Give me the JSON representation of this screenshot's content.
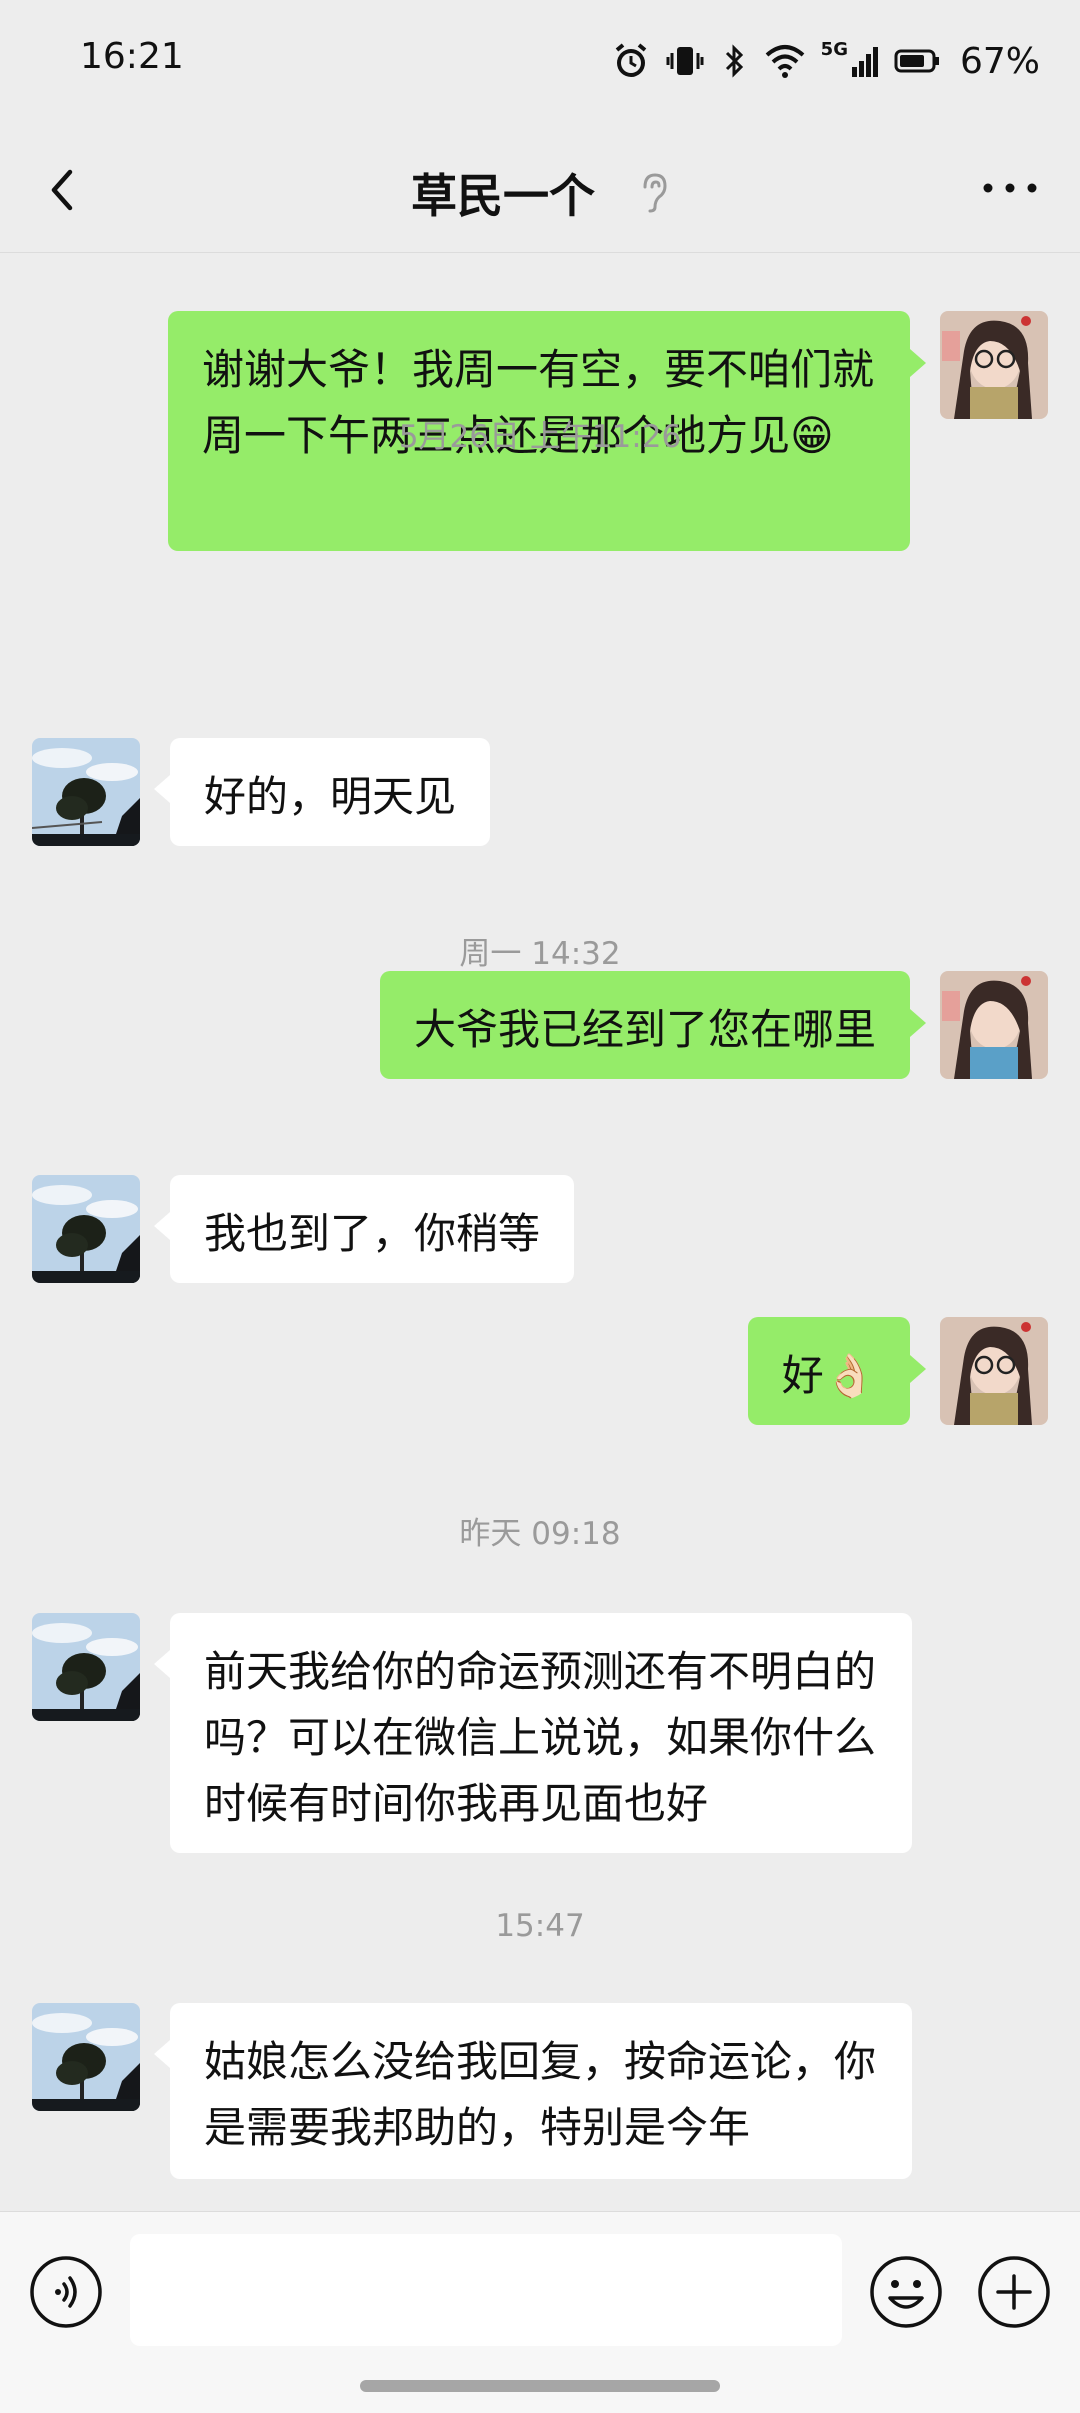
{
  "status_bar": {
    "time": "16:21",
    "network": "5G",
    "battery": "67%"
  },
  "nav": {
    "title": "草民一个"
  },
  "messages": [
    {
      "side": "right",
      "text": "谢谢大爷！我周一有空，要不咱们就周一下午两三点还是那个地方见😁"
    },
    {
      "timestamp": "5月26日 上午11:26"
    },
    {
      "side": "left",
      "text": "好的，明天见"
    },
    {
      "timestamp": "周一 14:32"
    },
    {
      "side": "right",
      "text": "大爷我已经到了您在哪里"
    },
    {
      "side": "left",
      "text": "我也到了，你稍等"
    },
    {
      "side": "right",
      "text": "好👌🏻"
    },
    {
      "timestamp": "昨天 09:18"
    },
    {
      "side": "left",
      "text": "前天我给你的命运预测还有不明白的吗？可以在微信上说说，如果你什么时候有时间你我再见面也好"
    },
    {
      "timestamp": "15:47"
    },
    {
      "side": "left",
      "text": "姑娘怎么没给我回复，按命运论，你是需要我邦助的，特别是今年"
    }
  ],
  "colors": {
    "sent_bubble": "#95ec69",
    "received_bubble": "#ffffff",
    "background": "#ededed"
  }
}
